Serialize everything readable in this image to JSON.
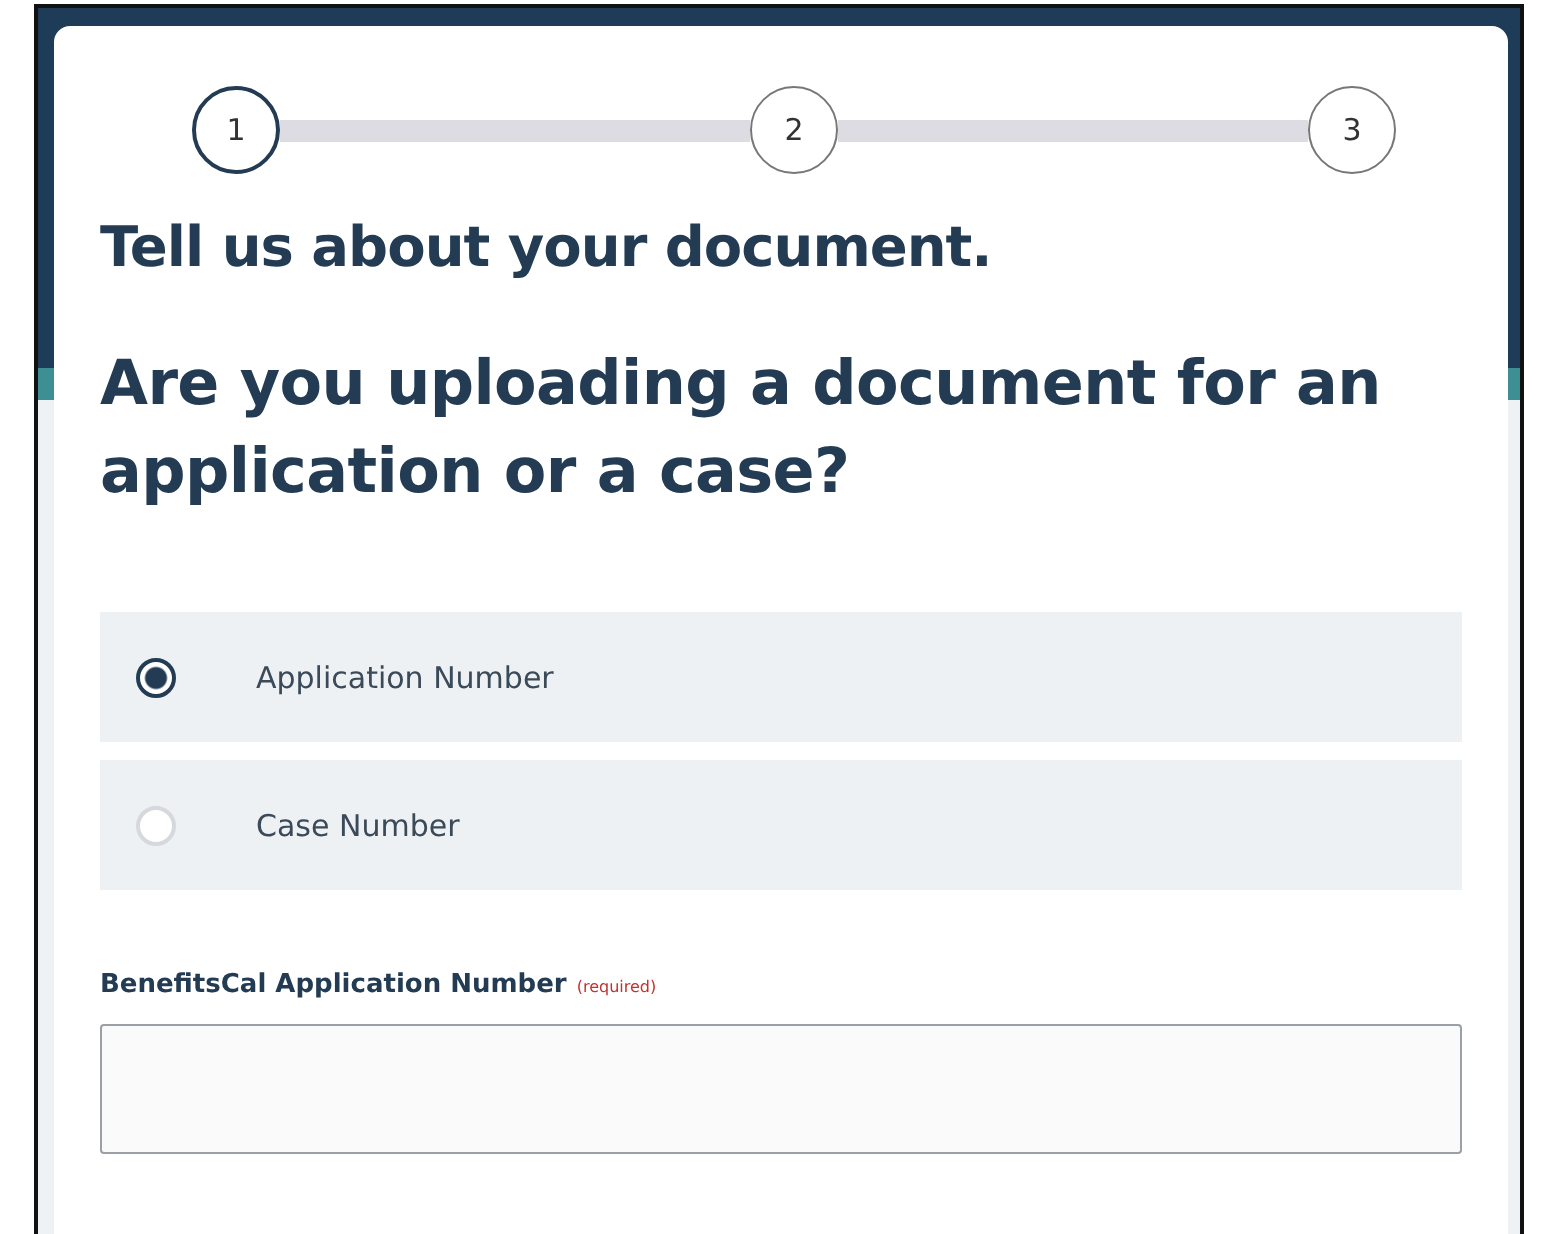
{
  "steps": [
    {
      "label": "1",
      "current": true
    },
    {
      "label": "2",
      "current": false
    },
    {
      "label": "3",
      "current": false
    }
  ],
  "title": "Tell us about your document.",
  "question": "Are you uploading a document for an application or a case?",
  "options": [
    {
      "label": "Application Number",
      "selected": true
    },
    {
      "label": "Case Number",
      "selected": false
    }
  ],
  "field": {
    "label": "BenefitsCal Application Number",
    "required": "(required)"
  }
}
